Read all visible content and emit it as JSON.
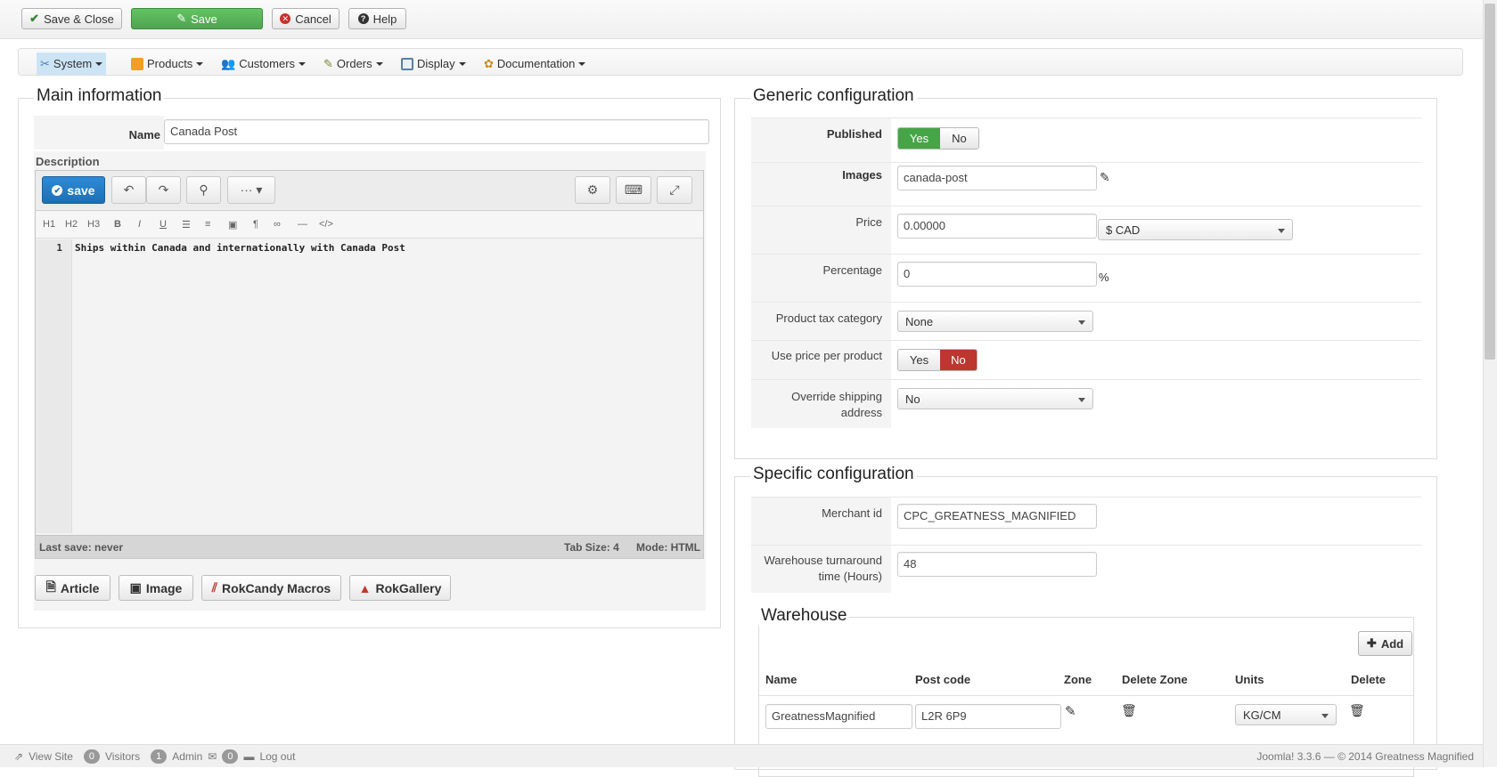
{
  "toolbar": {
    "save_close": "Save & Close",
    "save": "Save",
    "cancel": "Cancel",
    "help": "Help"
  },
  "menu": {
    "items": [
      "System",
      "Products",
      "Customers",
      "Orders",
      "Display",
      "Documentation"
    ]
  },
  "main_info": {
    "legend": "Main information",
    "name_label": "Name",
    "name_value": "Canada Post",
    "description_label": "Description",
    "editor": {
      "save_label": "save",
      "format_buttons": [
        "H1",
        "H2",
        "H3",
        "B",
        "I",
        "U",
        "☰",
        "≡",
        "▣",
        "¶",
        "∞",
        "—",
        "</>"
      ],
      "line_number": "1",
      "content": "Ships within Canada and internationally with Canada Post",
      "status_left": "Last save: never",
      "tab_size": "Tab Size: 4",
      "mode": "Mode: HTML"
    },
    "buttons": [
      "Article",
      "Image",
      "RokCandy Macros",
      "RokGallery"
    ]
  },
  "generic": {
    "legend": "Generic configuration",
    "published_label": "Published",
    "yes": "Yes",
    "no": "No",
    "images_label": "Images",
    "images_value": "canada-post",
    "price_label": "Price",
    "price_value": "0.00000",
    "currency": "$ CAD",
    "percentage_label": "Percentage",
    "percentage_value": "0",
    "percent_sign": "%",
    "tax_label": "Product tax category",
    "tax_value": "None",
    "use_price_label": "Use price per product",
    "override_label_1": "Override shipping",
    "override_label_2": "address",
    "override_value": "No"
  },
  "specific": {
    "legend": "Specific configuration",
    "merchant_label": "Merchant id",
    "merchant_value": "CPC_GREATNESS_MAGNIFIED",
    "turnaround_label_1": "Warehouse turnaround",
    "turnaround_label_2": "time (Hours)",
    "turnaround_value": "48",
    "warehouse": {
      "legend": "Warehouse",
      "add": "Add",
      "columns": [
        "Name",
        "Post code",
        "Zone",
        "Delete Zone",
        "Units",
        "Delete"
      ],
      "row": {
        "name": "GreatnessMagnified",
        "post_code": "L2R 6P9",
        "units": "KG/CM"
      }
    }
  },
  "footer": {
    "view_site": "View Site",
    "visitors_count": "0",
    "visitors": "Visitors",
    "admin_count": "1",
    "admin": "Admin",
    "messages_count": "0",
    "logout": "Log out",
    "version": "Joomla! 3.3.6",
    "copyright": "— © 2014 Greatness Magnified"
  }
}
